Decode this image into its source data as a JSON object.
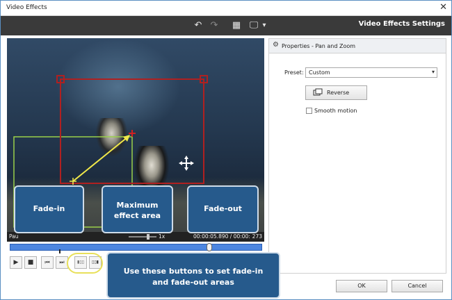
{
  "window": {
    "title": "Video Effects",
    "close_glyph": "✕"
  },
  "toolbar": {
    "heading": "Video Effects Settings",
    "undo_icon": "↶",
    "redo_icon": "↷",
    "grid_icon": "▦",
    "monitor_icon": "🖵",
    "dropdown_icon": "▾"
  },
  "video_status": {
    "left_text": "Pau",
    "zoom_text": "1x",
    "time_text": "00:00:05.890  /  00:00:",
    "frame_text": "273"
  },
  "controls": {
    "play": "▶",
    "stop": "■",
    "prev": "⏮",
    "next": "⏭",
    "fadein": "▮▯▯",
    "fadeout": "▯▯▮"
  },
  "timeline": {
    "position_fraction": 0.8
  },
  "panel": {
    "title": "Properties - Pan and Zoom",
    "gear_icon": "⚙",
    "preset_label": "Preset:",
    "preset_value": "Custom",
    "preset_arrow": "▾",
    "reverse_label": "Reverse",
    "smooth_label": "Smooth motion"
  },
  "buttons": {
    "ok": "OK",
    "cancel": "Cancel"
  },
  "callouts": {
    "fade_in": "Fade-in",
    "max_effect_line1": "Maximum",
    "max_effect_line2": "effect area",
    "fade_out": "Fade-out",
    "buttons_line1": "Use these buttons to set fade-in",
    "buttons_line2": "and fade-out areas"
  },
  "colors": {
    "accent_blue": "#265a8c",
    "timeline_blue": "#4d86e0",
    "max_rect": "#b02020",
    "start_rect": "#9ad04a",
    "highlight": "#e8e05a"
  }
}
